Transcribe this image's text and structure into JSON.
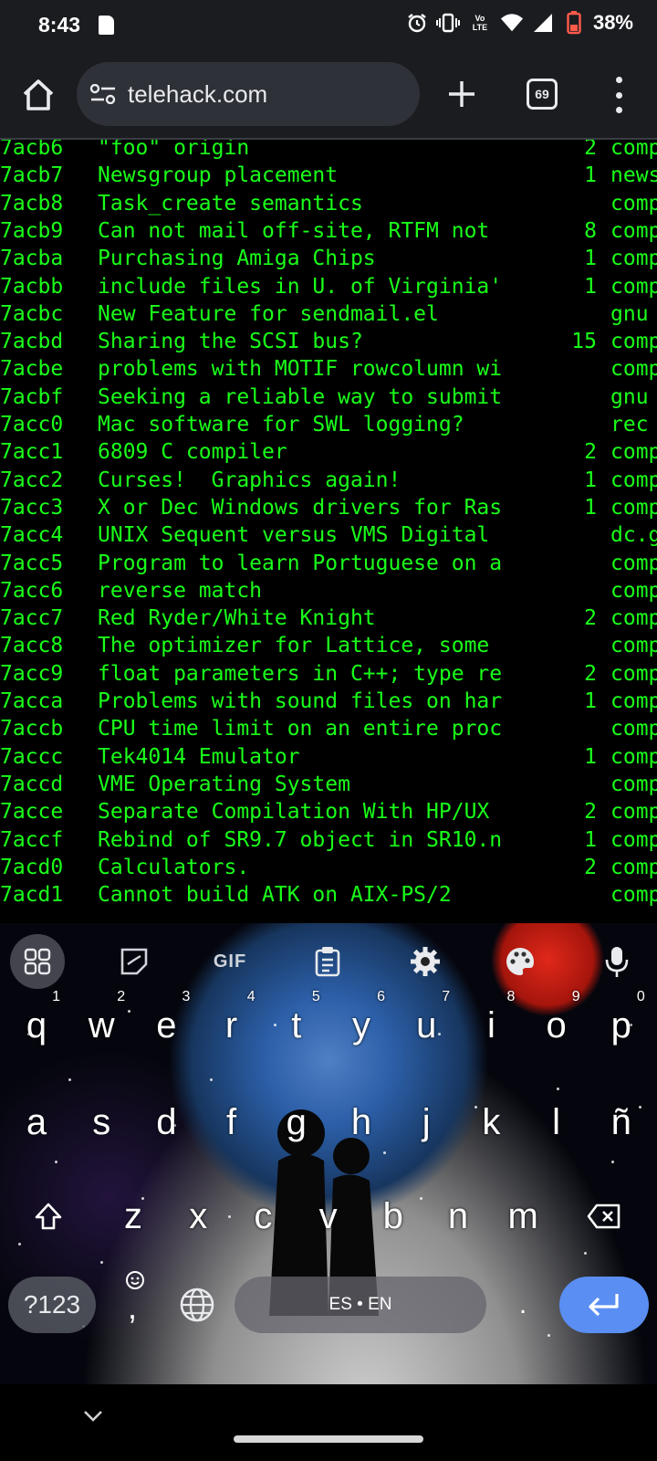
{
  "status_bar": {
    "time": "8:43",
    "volte_top": "Vo",
    "volte_bottom": "LTE",
    "battery_percent": "38%"
  },
  "browser": {
    "url": "telehack.com",
    "tab_count": "69"
  },
  "terminal": {
    "text_color": "#1aff1a",
    "rows": [
      {
        "id": "7acb6",
        "subject": "\"foo\" origin",
        "count": "2",
        "group": "comp"
      },
      {
        "id": "7acb7",
        "subject": "Newsgroup placement",
        "count": "1",
        "group": "news"
      },
      {
        "id": "7acb8",
        "subject": "Task_create semantics",
        "count": "",
        "group": "comp"
      },
      {
        "id": "7acb9",
        "subject": "Can not mail off-site, RTFM not",
        "count": "8",
        "group": "comp"
      },
      {
        "id": "7acba",
        "subject": "Purchasing Amiga Chips",
        "count": "1",
        "group": "comp"
      },
      {
        "id": "7acbb",
        "subject": "include files in U. of Virginia'",
        "count": "1",
        "group": "comp"
      },
      {
        "id": "7acbc",
        "subject": "New Feature for sendmail.el",
        "count": "",
        "group": "gnu"
      },
      {
        "id": "7acbd",
        "subject": "Sharing the SCSI bus?",
        "count": "15",
        "group": "comp"
      },
      {
        "id": "7acbe",
        "subject": "problems with MOTIF rowcolumn wi",
        "count": "",
        "group": "comp"
      },
      {
        "id": "7acbf",
        "subject": "Seeking a reliable way to submit",
        "count": "",
        "group": "gnu"
      },
      {
        "id": "7acc0",
        "subject": "Mac software for SWL logging?",
        "count": "",
        "group": "rec"
      },
      {
        "id": "7acc1",
        "subject": "6809 C compiler",
        "count": "2",
        "group": "comp"
      },
      {
        "id": "7acc2",
        "subject": "Curses!  Graphics again!",
        "count": "1",
        "group": "comp"
      },
      {
        "id": "7acc3",
        "subject": "X or Dec Windows drivers for Ras",
        "count": "1",
        "group": "comp"
      },
      {
        "id": "7acc4",
        "subject": "UNIX Sequent versus VMS Digital",
        "count": "",
        "group": "dc.g"
      },
      {
        "id": "7acc5",
        "subject": "Program to learn Portuguese on a",
        "count": "",
        "group": "comp"
      },
      {
        "id": "7acc6",
        "subject": "reverse match",
        "count": "",
        "group": "comp"
      },
      {
        "id": "7acc7",
        "subject": "Red Ryder/White Knight",
        "count": "2",
        "group": "comp"
      },
      {
        "id": "7acc8",
        "subject": "The optimizer for Lattice, some",
        "count": "",
        "group": "comp"
      },
      {
        "id": "7acc9",
        "subject": "float parameters in C++; type re",
        "count": "2",
        "group": "comp"
      },
      {
        "id": "7acca",
        "subject": "Problems with sound files on har",
        "count": "1",
        "group": "comp"
      },
      {
        "id": "7accb",
        "subject": "CPU time limit on an entire proc",
        "count": "",
        "group": "comp"
      },
      {
        "id": "7accc",
        "subject": "Tek4014 Emulator",
        "count": "1",
        "group": "comp"
      },
      {
        "id": "7accd",
        "subject": "VME Operating System",
        "count": "",
        "group": "comp"
      },
      {
        "id": "7acce",
        "subject": "Separate Compilation With HP/UX",
        "count": "2",
        "group": "comp"
      },
      {
        "id": "7accf",
        "subject": "Rebind of SR9.7 object in SR10.n",
        "count": "1",
        "group": "comp"
      },
      {
        "id": "7acd0",
        "subject": "Calculators.",
        "count": "2",
        "group": "comp"
      },
      {
        "id": "7acd1",
        "subject": "Cannot build ATK on AIX-PS/2",
        "count": "",
        "group": "comp"
      }
    ]
  },
  "keyboard": {
    "toolbar": {
      "gif_label": "GIF"
    },
    "row1": [
      {
        "key": "q",
        "hint": "1"
      },
      {
        "key": "w",
        "hint": "2"
      },
      {
        "key": "e",
        "hint": "3"
      },
      {
        "key": "r",
        "hint": "4"
      },
      {
        "key": "t",
        "hint": "5"
      },
      {
        "key": "y",
        "hint": "6"
      },
      {
        "key": "u",
        "hint": "7"
      },
      {
        "key": "i",
        "hint": "8"
      },
      {
        "key": "o",
        "hint": "9"
      },
      {
        "key": "p",
        "hint": "0"
      }
    ],
    "row2": [
      "a",
      "s",
      "d",
      "f",
      "g",
      "h",
      "j",
      "k",
      "l",
      "ñ"
    ],
    "row3": [
      "z",
      "x",
      "c",
      "v",
      "b",
      "n",
      "m"
    ],
    "symbols_label": "?123",
    "comma_label": ",",
    "space_label": "ES • EN",
    "period_label": ".",
    "enter_color": "#5a8ef2"
  }
}
